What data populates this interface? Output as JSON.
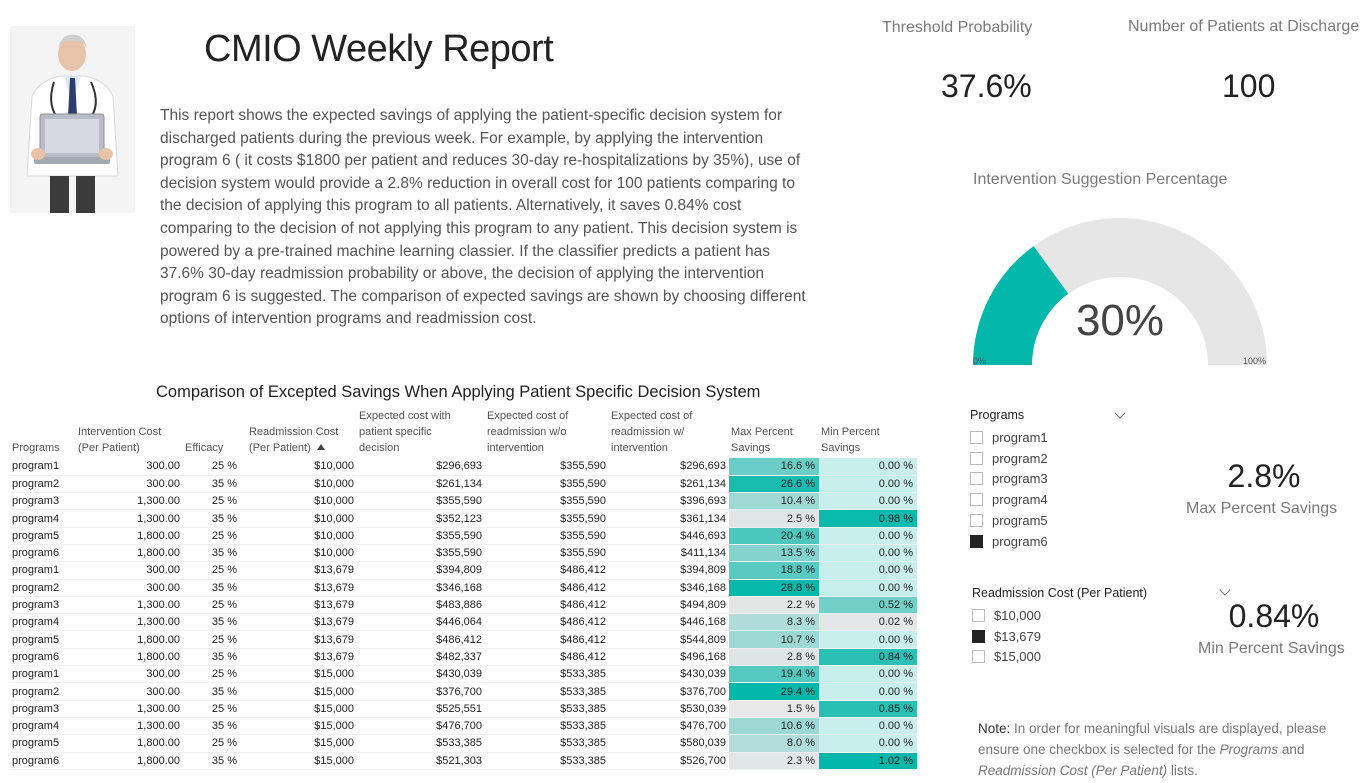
{
  "report": {
    "title": "CMIO Weekly Report",
    "intro": "This report shows the expected savings of applying the patient-specific decision system for discharged patients during the previous week. For example, by applying the intervention program 6 ( it costs $1800 per patient and reduces 30-day re-hospitalizations by 35%), use of decision system would provide a 2.8% reduction in overall cost for 100 patients comparing to the decision of applying this program to all patients. Alternatively, it saves 0.84% cost comparing to the decision of not applying this program to any patient. This decision system is powered by a pre-trained machine learning classier. If the classifier predicts a patient has 37.6% 30-day readmission probability or above, the decision of applying the intervention program 6 is suggested. The comparison of expected savings are shown by choosing different options of intervention programs and readmission cost."
  },
  "kpis": {
    "threshold": {
      "label": "Threshold Probability",
      "value": "37.6%"
    },
    "patients": {
      "label": "Number of Patients at Discharge",
      "value": "100"
    },
    "max_savings": {
      "label": "Max Percent Savings",
      "value": "2.8%"
    },
    "min_savings": {
      "label": "Min Percent Savings",
      "value": "0.84%"
    }
  },
  "gauge": {
    "title": "Intervention Suggestion Percentage",
    "value_label": "30%",
    "value_fraction": 0.3,
    "min_label": "0%",
    "max_label": "100%",
    "fill_color": "#01b8aa",
    "track_color": "#e6e6e6"
  },
  "table": {
    "title": "Comparison of Excepted Savings When Applying Patient Specific Decision System",
    "columns": [
      "Programs",
      "Intervention Cost\n(Per Patient)",
      "Efficacy",
      "Readmission Cost\n(Per Patient)",
      "Expected cost with\npatient specific\ndecision",
      "Expected cost of\nreadmission w/o\nintervention",
      "Expected cost of\nreadmission w/\nintervention",
      "Max Percent\nSavings",
      "Min Percent\nSavings"
    ],
    "sort_column": "Readmission Cost\n(Per Patient)",
    "rows": [
      [
        "program1",
        "300.00",
        "25 %",
        "$10,000",
        "$296,693",
        "$355,590",
        "$296,693",
        "16.6 %",
        "0.00 %"
      ],
      [
        "program2",
        "300.00",
        "35 %",
        "$10,000",
        "$261,134",
        "$355,590",
        "$261,134",
        "26.6 %",
        "0.00 %"
      ],
      [
        "program3",
        "1,300.00",
        "25 %",
        "$10,000",
        "$355,590",
        "$355,590",
        "$396,693",
        "10.4 %",
        "0.00 %"
      ],
      [
        "program4",
        "1,300.00",
        "35 %",
        "$10,000",
        "$352,123",
        "$355,590",
        "$361,134",
        "2.5 %",
        "0.98 %"
      ],
      [
        "program5",
        "1,800.00",
        "25 %",
        "$10,000",
        "$355,590",
        "$355,590",
        "$446,693",
        "20.4 %",
        "0.00 %"
      ],
      [
        "program6",
        "1,800.00",
        "35 %",
        "$10,000",
        "$355,590",
        "$355,590",
        "$411,134",
        "13.5 %",
        "0.00 %"
      ],
      [
        "program1",
        "300.00",
        "25 %",
        "$13,679",
        "$394,809",
        "$486,412",
        "$394,809",
        "18.8 %",
        "0.00 %"
      ],
      [
        "program2",
        "300.00",
        "35 %",
        "$13,679",
        "$346,168",
        "$486,412",
        "$346,168",
        "28.8 %",
        "0.00 %"
      ],
      [
        "program3",
        "1,300.00",
        "25 %",
        "$13,679",
        "$483,886",
        "$486,412",
        "$494,809",
        "2.2 %",
        "0.52 %"
      ],
      [
        "program4",
        "1,300.00",
        "35 %",
        "$13,679",
        "$446,064",
        "$486,412",
        "$446,168",
        "8.3 %",
        "0.02 %"
      ],
      [
        "program5",
        "1,800.00",
        "25 %",
        "$13,679",
        "$486,412",
        "$486,412",
        "$544,809",
        "10.7 %",
        "0.00 %"
      ],
      [
        "program6",
        "1,800.00",
        "35 %",
        "$13,679",
        "$482,337",
        "$486,412",
        "$496,168",
        "2.8 %",
        "0.84 %"
      ],
      [
        "program1",
        "300.00",
        "25 %",
        "$15,000",
        "$430,039",
        "$533,385",
        "$430,039",
        "19.4 %",
        "0.00 %"
      ],
      [
        "program2",
        "300.00",
        "35 %",
        "$15,000",
        "$376,700",
        "$533,385",
        "$376,700",
        "29.4 %",
        "0.00 %"
      ],
      [
        "program3",
        "1,300.00",
        "25 %",
        "$15,000",
        "$525,551",
        "$533,385",
        "$530,039",
        "1.5 %",
        "0.85 %"
      ],
      [
        "program4",
        "1,300.00",
        "35 %",
        "$15,000",
        "$476,700",
        "$533,385",
        "$476,700",
        "10.6 %",
        "0.00 %"
      ],
      [
        "program5",
        "1,800.00",
        "25 %",
        "$15,000",
        "$533,385",
        "$533,385",
        "$580,039",
        "8.0 %",
        "0.00 %"
      ],
      [
        "program6",
        "1,800.00",
        "35 %",
        "$15,000",
        "$521,303",
        "$533,385",
        "$526,700",
        "2.3 %",
        "1.02 %"
      ]
    ],
    "heat_low_color": "#e8e8e8",
    "heat_high_color": "#01b8aa"
  },
  "slicers": {
    "programs": {
      "title": "Programs",
      "items": [
        {
          "label": "program1",
          "checked": false
        },
        {
          "label": "program2",
          "checked": false
        },
        {
          "label": "program3",
          "checked": false
        },
        {
          "label": "program4",
          "checked": false
        },
        {
          "label": "program5",
          "checked": false
        },
        {
          "label": "program6",
          "checked": true
        }
      ]
    },
    "readmission": {
      "title": "Readmission Cost (Per Patient)",
      "items": [
        {
          "label": "$10,000",
          "checked": false
        },
        {
          "label": "$13,679",
          "checked": true
        },
        {
          "label": "$15,000",
          "checked": false
        }
      ]
    }
  },
  "note": {
    "label": "Note:",
    "text_1": " In order for meaningful visuals are displayed, please ensure one checkbox is selected for the ",
    "emph_1": "Programs",
    "text_2": " and ",
    "emph_2": "Readmission Cost (Per Patient)",
    "text_3": " lists."
  },
  "icons": {
    "doctor_photo": "doctor-with-laptop-image",
    "sort": "sort-ascending-icon",
    "dropdown": "chevron-down-icon",
    "checkbox": "checkbox-icon"
  }
}
